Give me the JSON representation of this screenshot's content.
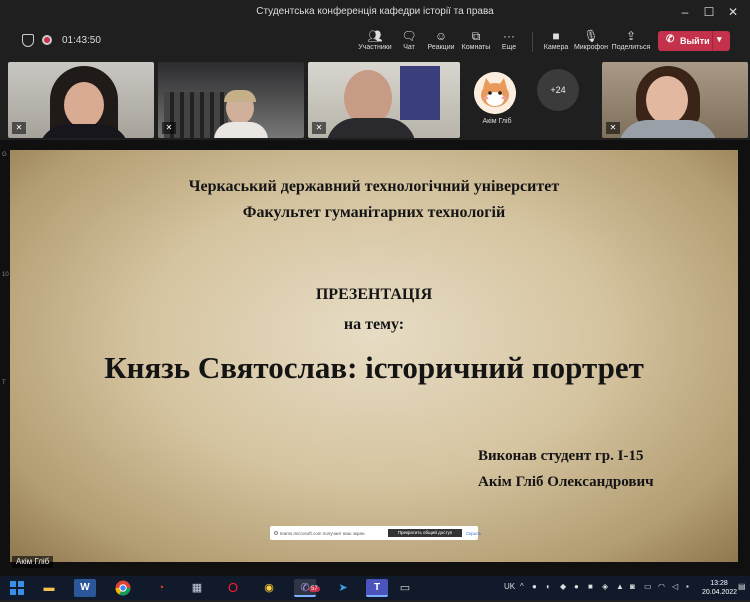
{
  "window": {
    "title": "Студентська конференція кафедри історії та права"
  },
  "toolbar": {
    "timer": "01:43:50",
    "participants_label": "Участники",
    "chat_label": "Чат",
    "reactions_label": "Реакции",
    "rooms_label": "Комнаты",
    "more_label": "Еще",
    "camera_label": "Камера",
    "mic_label": "Микрофон",
    "share_label": "Поделиться",
    "leave_label": "Выйти"
  },
  "participants": {
    "avatar_name": "Акім Гліб",
    "more_count": "+24"
  },
  "slide": {
    "line1": "Черкаський державний технологічний університет",
    "line2": "Факультет гуманітарних технологій",
    "line3": "ПРЕЗЕНТАЦІЯ",
    "line4": "на тему:",
    "title": "Князь Святослав: історичний портрет",
    "author1": "Виконав студент гр. І-15",
    "author2": "Акім Гліб Олександрович"
  },
  "notification": {
    "text": "teams.microsoft.com получает ваш экран.",
    "stop_label": "Прекратить общий доступ",
    "hide_label": "Скрыть"
  },
  "presenter_chip": "Акім Гліб",
  "taskbar": {
    "language": "UK",
    "time": "13:28",
    "date": "20.04.2022",
    "viber_badge": "57"
  },
  "colors": {
    "leave": "#c4314b",
    "taskbar": "#101a2a",
    "slide_center": "#e7dcc4"
  }
}
